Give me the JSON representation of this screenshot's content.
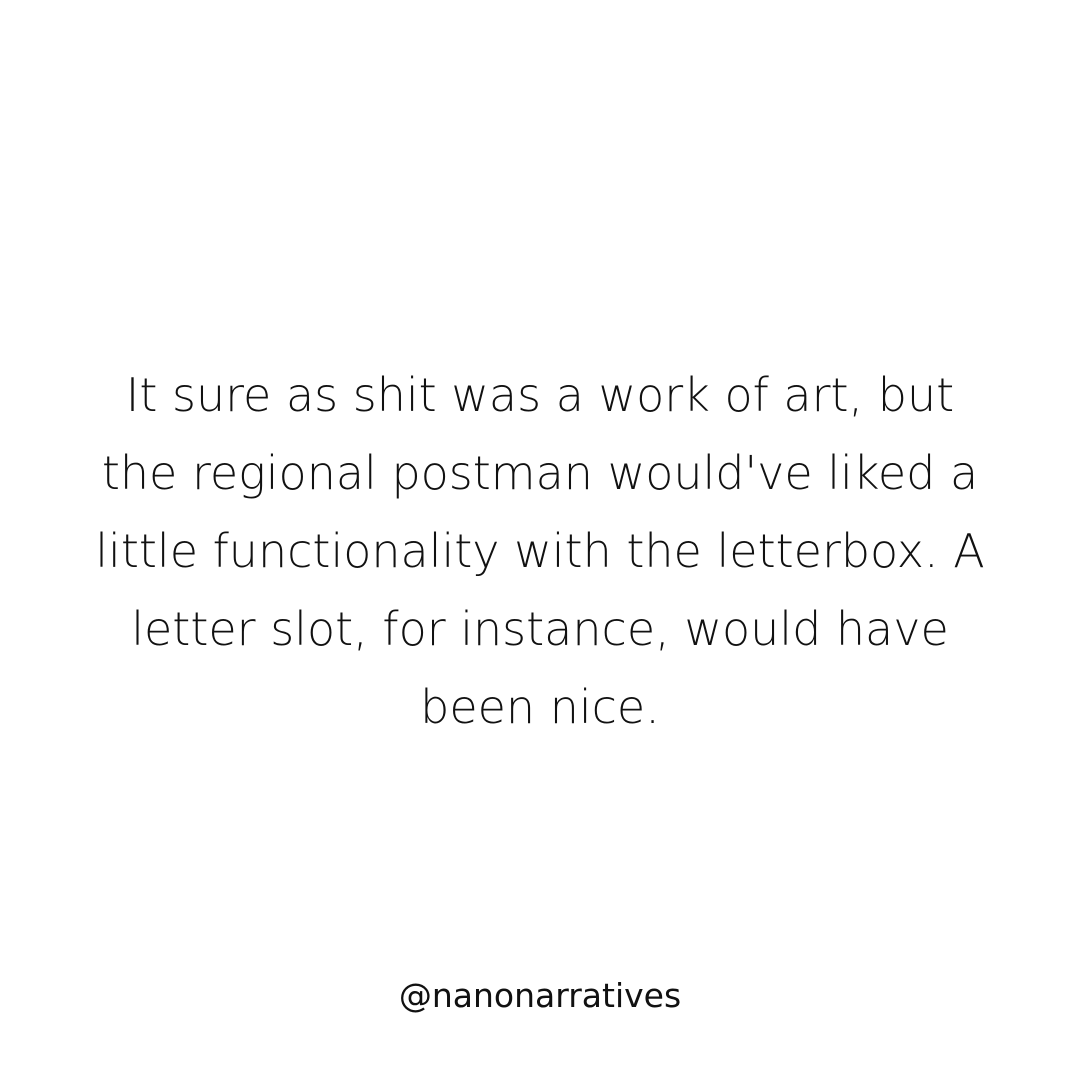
{
  "quote": {
    "lines": [
      "It sure as shit was a work of art, but",
      "the regional postman would've liked a",
      "little functionality with the letterbox. A",
      "letter slot, for instance, would have",
      "been nice."
    ]
  },
  "footer": {
    "handle": "@nanonarratives"
  },
  "colors": {
    "background": "#ffffff",
    "text": "#111111"
  }
}
